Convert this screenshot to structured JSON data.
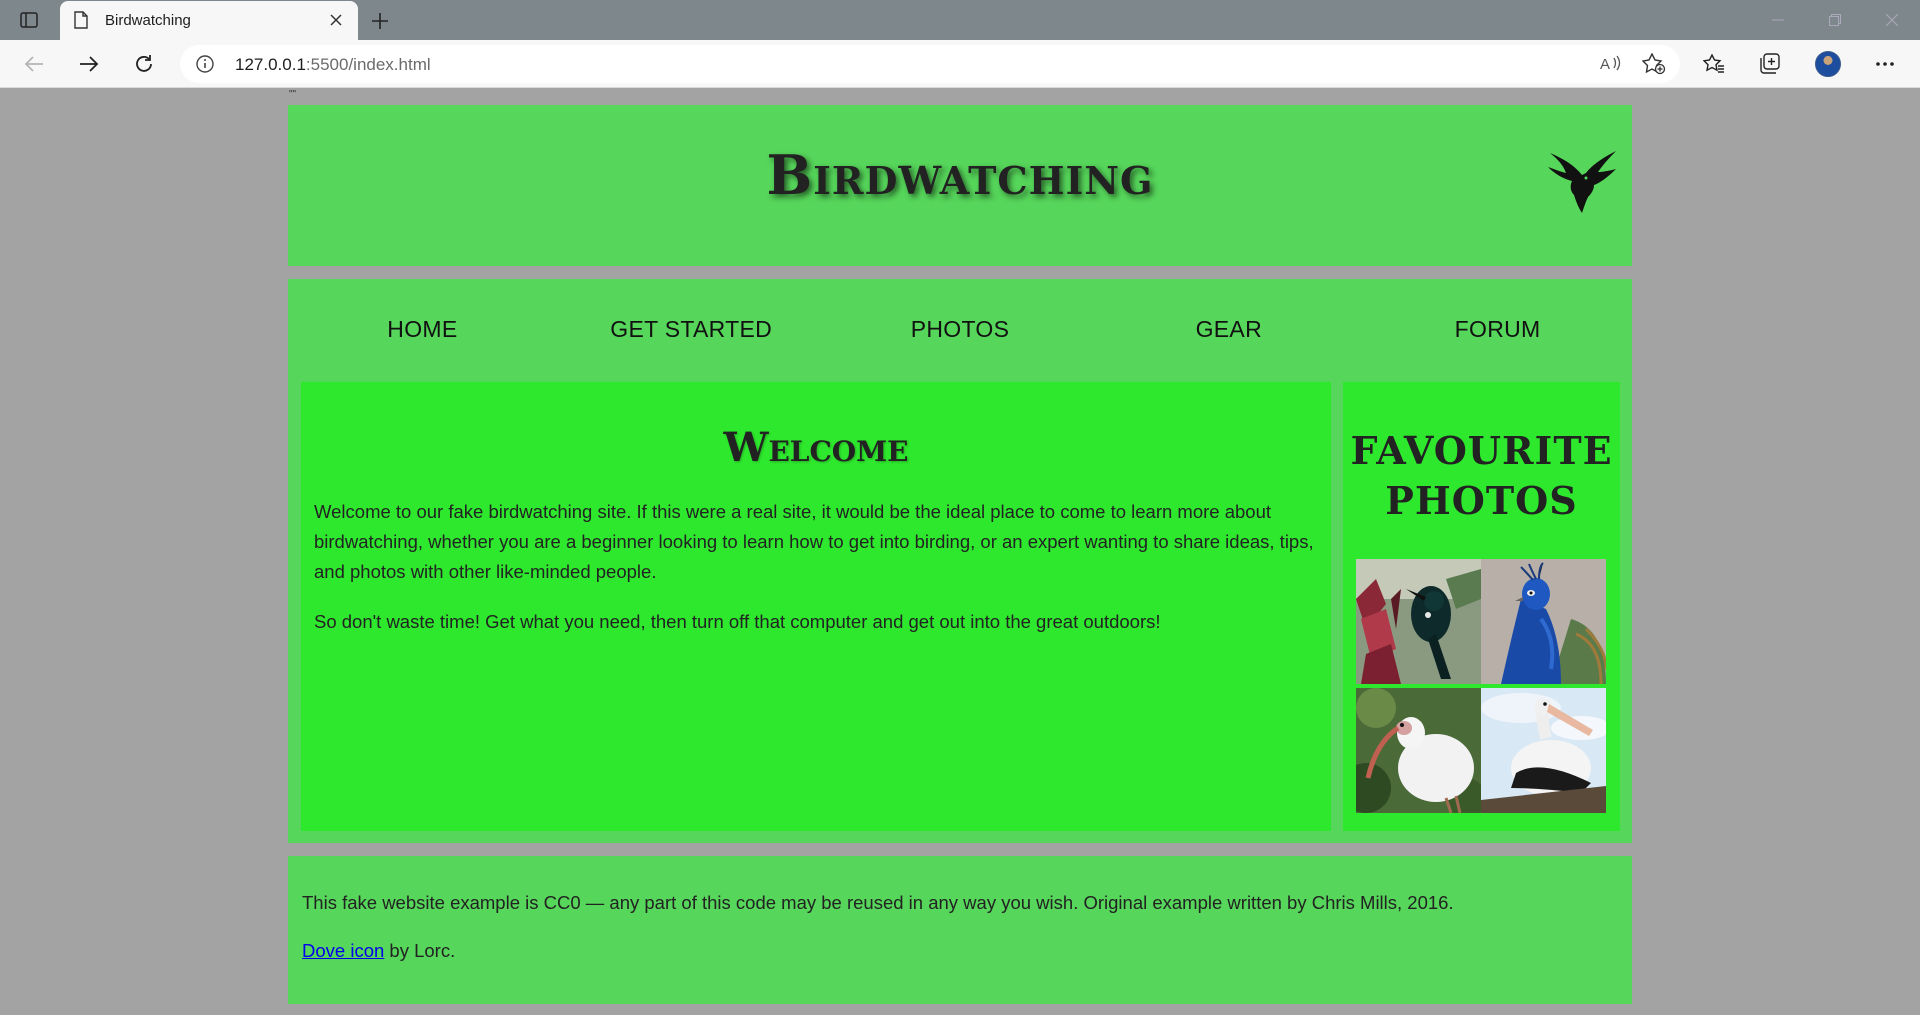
{
  "browser": {
    "tab_title": "Birdwatching",
    "url_host": "127.0.0.1",
    "url_rest": ":5500/index.html"
  },
  "page": {
    "stray_text": "\"\"",
    "header": {
      "title": "Birdwatching"
    },
    "nav": {
      "items": [
        {
          "label": "HOME"
        },
        {
          "label": "GET STARTED"
        },
        {
          "label": "PHOTOS"
        },
        {
          "label": "GEAR"
        },
        {
          "label": "FORUM"
        }
      ]
    },
    "main": {
      "heading": "Welcome",
      "paragraphs": [
        "Welcome to our fake birdwatching site. If this were a real site, it would be the ideal place to come to learn more about birdwatching, whether you are a beginner looking to learn how to get into birding, or an expert wanting to share ideas, tips, and photos with other like-minded people.",
        "So don't waste time! Get what you need, then turn off that computer and get out into the great outdoors!"
      ]
    },
    "aside": {
      "heading": "FAVOURITE PHOTOS",
      "photos": [
        "tui-photo",
        "peacock-photo",
        "ibis-photo",
        "pelican-photo"
      ]
    },
    "footer": {
      "license_text": "This fake website example is CC0 — any part of this code may be reused in any way you wish. Original example written by Chris Mills, 2016.",
      "credit_link": "Dove icon",
      "credit_suffix": " by Lorc."
    }
  }
}
